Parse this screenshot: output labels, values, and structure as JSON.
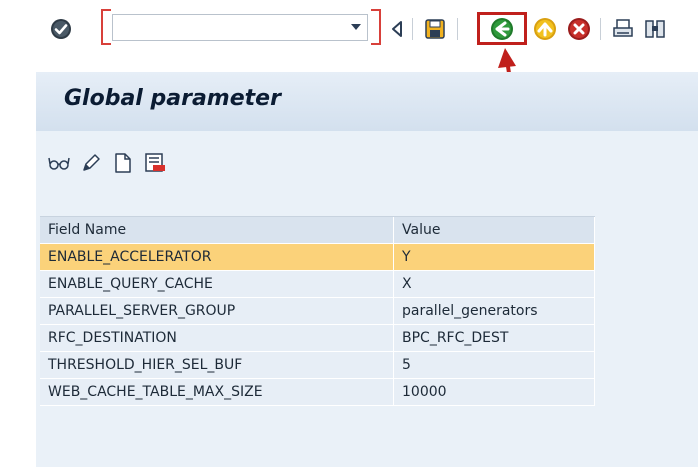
{
  "toolbar": {
    "command_field_value": "",
    "icons": [
      "checkmark-icon",
      "back-arrow-icon",
      "save-icon",
      "back-icon",
      "exit-icon",
      "cancel-icon",
      "print-icon",
      "find-icon"
    ]
  },
  "header": {
    "title": "Global parameter"
  },
  "app_toolbar": {
    "icons": [
      "glasses-icon",
      "pencil-icon",
      "new-document-icon",
      "delete-row-icon"
    ]
  },
  "table": {
    "columns": [
      "Field Name",
      "Value"
    ],
    "rows": [
      {
        "field": "ENABLE_ACCELERATOR",
        "value": "Y",
        "selected": true
      },
      {
        "field": "ENABLE_QUERY_CACHE",
        "value": "X",
        "selected": false
      },
      {
        "field": "PARALLEL_SERVER_GROUP",
        "value": "parallel_generators",
        "selected": false
      },
      {
        "field": "RFC_DESTINATION",
        "value": "BPC_RFC_DEST",
        "selected": false
      },
      {
        "field": "THRESHOLD_HIER_SEL_BUF",
        "value": "5",
        "selected": false
      },
      {
        "field": "WEB_CACHE_TABLE_MAX_SIZE",
        "value": "10000",
        "selected": false
      }
    ]
  },
  "colors": {
    "accent": "#c0201c",
    "selected_row": "#fbd27a",
    "header_bg": "#d9e3ee"
  }
}
